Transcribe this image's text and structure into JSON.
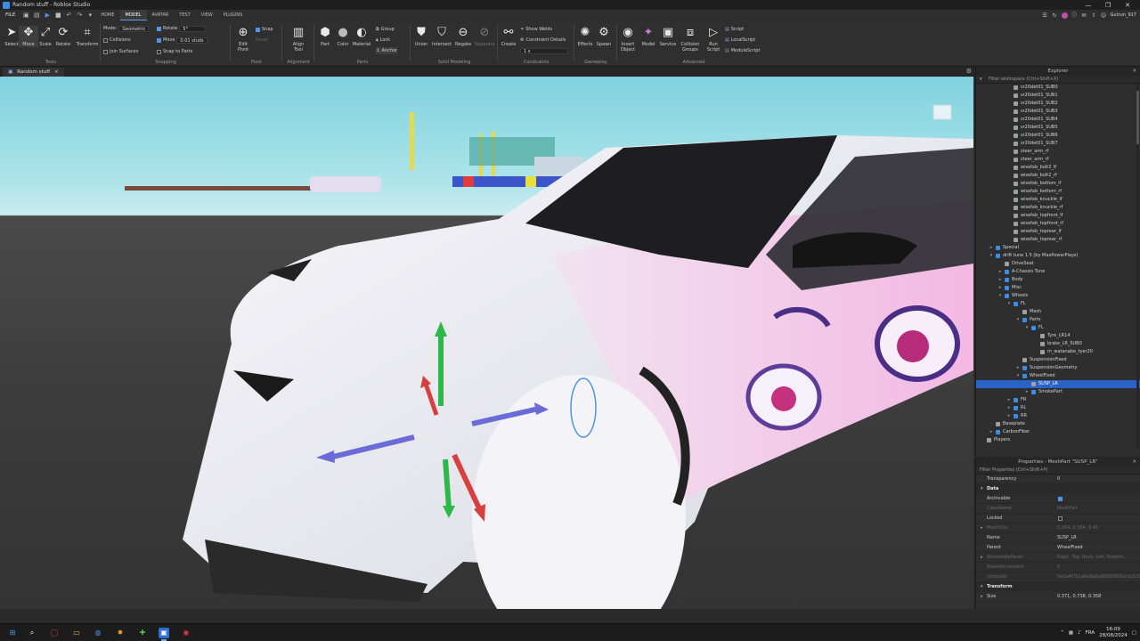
{
  "window": {
    "title": "Random stuff - Roblox Studio",
    "controls": [
      "—",
      "❐",
      "✕"
    ]
  },
  "menu": {
    "file": "FILE",
    "tabs": [
      "HOME",
      "MODEL",
      "AVATAR",
      "TEST",
      "VIEW",
      "PLUGINS"
    ],
    "active_tab": "MODEL",
    "user": "Gutrun_917"
  },
  "ribbon": {
    "tools": {
      "label": "Tools",
      "items": [
        "Select",
        "Move",
        "Scale",
        "Rotate",
        "Transform"
      ]
    },
    "snapping": {
      "label": "Snapping",
      "mode_label": "Mode:",
      "mode_value": "Geometric",
      "collisions": "Collisions",
      "join_surfaces": "Join Surfaces",
      "rotate": "Rotate",
      "rotate_value": "5°",
      "move": "Move",
      "move_value": "0.01 studs",
      "snap_to_parts": "Snap to Parts"
    },
    "pivot": {
      "label": "Pivot",
      "edit_pivot": "Edit Pivot",
      "snap": "Snap",
      "reset": "Reset"
    },
    "alignment": {
      "label": "Alignment",
      "align_tool": "Align Tool"
    },
    "parts": {
      "label": "Parts",
      "items": [
        "Part",
        "Color",
        "Material"
      ],
      "group": "Group",
      "lock": "Lock",
      "anchor": "Anchor"
    },
    "solid": {
      "label": "Solid Modeling",
      "items": [
        "Union",
        "Intersect",
        "Negate",
        "Separate"
      ]
    },
    "constraints": {
      "label": "Constraints",
      "create": "Create",
      "show_welds": "Show Welds",
      "constraint_details": "Constraint Details",
      "scale_value": "1 x"
    },
    "gameplay": {
      "label": "Gameplay",
      "items": [
        "Effects",
        "Spawn"
      ]
    },
    "advanced": {
      "label": "Advanced",
      "items": [
        "Insert Object",
        "Model",
        "Service",
        "Collision Groups",
        "Run Script"
      ],
      "scripts": [
        "Script",
        "LocalScript",
        "ModuleScript"
      ]
    }
  },
  "document": {
    "tab": "Random stuff",
    "close": "×"
  },
  "explorer": {
    "title": "Explorer",
    "filter": "Filter workspace (Ctrl+Shift+X)",
    "rows": [
      {
        "label": "sr20det01_SUB0",
        "depth": 3
      },
      {
        "label": "sr20det01_SUB1",
        "depth": 3
      },
      {
        "label": "sr20det01_SUB2",
        "depth": 3
      },
      {
        "label": "sr20det01_SUB3",
        "depth": 3
      },
      {
        "label": "sr20det01_SUB4",
        "depth": 3
      },
      {
        "label": "sr20det01_SUB5",
        "depth": 3
      },
      {
        "label": "sr20det01_SUB6",
        "depth": 3
      },
      {
        "label": "sr20det01_SUB7",
        "depth": 3
      },
      {
        "label": "steer_arm_rf",
        "depth": 3
      },
      {
        "label": "steer_arm_rf",
        "depth": 3
      },
      {
        "label": "wisefab_bolt2_lf",
        "depth": 3
      },
      {
        "label": "wisefab_bolt2_rf",
        "depth": 3
      },
      {
        "label": "wisefab_bottom_lf",
        "depth": 3
      },
      {
        "label": "wisefab_bottom_rf",
        "depth": 3
      },
      {
        "label": "wisefab_knuckle_lf",
        "depth": 3
      },
      {
        "label": "wisefab_knuckle_rf",
        "depth": 3
      },
      {
        "label": "wisefab_topfront_lf",
        "depth": 3
      },
      {
        "label": "wisefab_topfront_rf",
        "depth": 3
      },
      {
        "label": "wisefab_toprear_lf",
        "depth": 3
      },
      {
        "label": "wisefab_toprear_rf",
        "depth": 3
      },
      {
        "label": "Special",
        "depth": 1,
        "arrow": "▸"
      },
      {
        "label": "drift tune 1.5 (by MaxPowerPlays)",
        "depth": 1,
        "arrow": "▾"
      },
      {
        "label": "DriveSeat",
        "depth": 2
      },
      {
        "label": "A-Chassis Tune",
        "depth": 2,
        "arrow": "▸"
      },
      {
        "label": "Body",
        "depth": 2,
        "arrow": "▸"
      },
      {
        "label": "Misc",
        "depth": 2,
        "arrow": "▸"
      },
      {
        "label": "Wheels",
        "depth": 2,
        "arrow": "▾"
      },
      {
        "label": "FL",
        "depth": 3,
        "arrow": "▾"
      },
      {
        "label": "Mesh",
        "depth": 4
      },
      {
        "label": "Parts",
        "depth": 4,
        "arrow": "▾"
      },
      {
        "label": "FL",
        "depth": 5,
        "arrow": "▾"
      },
      {
        "label": "Tyre_LR14",
        "depth": 6
      },
      {
        "label": "brake_LR_SUB0",
        "depth": 6
      },
      {
        "label": "m_watanabe_tyer20",
        "depth": 6
      },
      {
        "label": "SuspensionFixed",
        "depth": 4
      },
      {
        "label": "SuspensionGeometry",
        "depth": 4,
        "arrow": "▸"
      },
      {
        "label": "WheelFixed",
        "depth": 4,
        "arrow": "▾"
      },
      {
        "label": "SUSP_LR",
        "depth": 5,
        "selected": true
      },
      {
        "label": "SmokePart",
        "depth": 5,
        "arrow": "▸"
      },
      {
        "label": "FR",
        "depth": 3,
        "arrow": "▸"
      },
      {
        "label": "RL",
        "depth": 3,
        "arrow": "▸"
      },
      {
        "label": "RR",
        "depth": 3,
        "arrow": "▸"
      },
      {
        "label": "Baseplate",
        "depth": 1
      },
      {
        "label": "CarbonFiber",
        "depth": 1,
        "arrow": "▸"
      },
      {
        "label": "Players",
        "depth": 0
      }
    ]
  },
  "properties": {
    "title": "Properties - MeshPart \"SUSP_LR\"",
    "filter": "Filter Properties (Ctrl+Shift+P)",
    "rows": [
      {
        "type": "prop",
        "name": "Transparency",
        "value": "0"
      },
      {
        "type": "section",
        "name": "Data"
      },
      {
        "type": "check",
        "name": "Archivable",
        "on": true
      },
      {
        "type": "prop",
        "name": "ClassName",
        "value": "MeshPart",
        "dim": true
      },
      {
        "type": "check",
        "name": "Locked",
        "on": false
      },
      {
        "type": "prop",
        "name": "MeshSize",
        "value": "0.364, 0.384, 0.45",
        "dim": true,
        "expand": true
      },
      {
        "type": "prop",
        "name": "Name",
        "value": "SUSP_LR"
      },
      {
        "type": "prop",
        "name": "Parent",
        "value": "WheelFixed"
      },
      {
        "type": "prop",
        "name": "ResizeableFaces",
        "value": "Right, Top, Back, Left, Bottom,...",
        "dim": true,
        "expand": true
      },
      {
        "type": "prop",
        "name": "ResizeIncrement",
        "value": "0",
        "dim": true
      },
      {
        "type": "prop",
        "name": "UniqueId",
        "value": "5e0a4f7b1e6e0a0a00000000a1b2c3d4",
        "dim": true
      },
      {
        "type": "section",
        "name": "Transform"
      },
      {
        "type": "prop",
        "name": "Size",
        "value": "0.371, 0.738, 0.358",
        "expand": true
      }
    ]
  },
  "taskbar": {
    "lang": "FRA",
    "time": "16:09",
    "date": "28/08/2024"
  },
  "colors": {
    "accent": "#2a62c7",
    "ribbon": "#2f2f2f",
    "panel": "#2e2e2e"
  }
}
